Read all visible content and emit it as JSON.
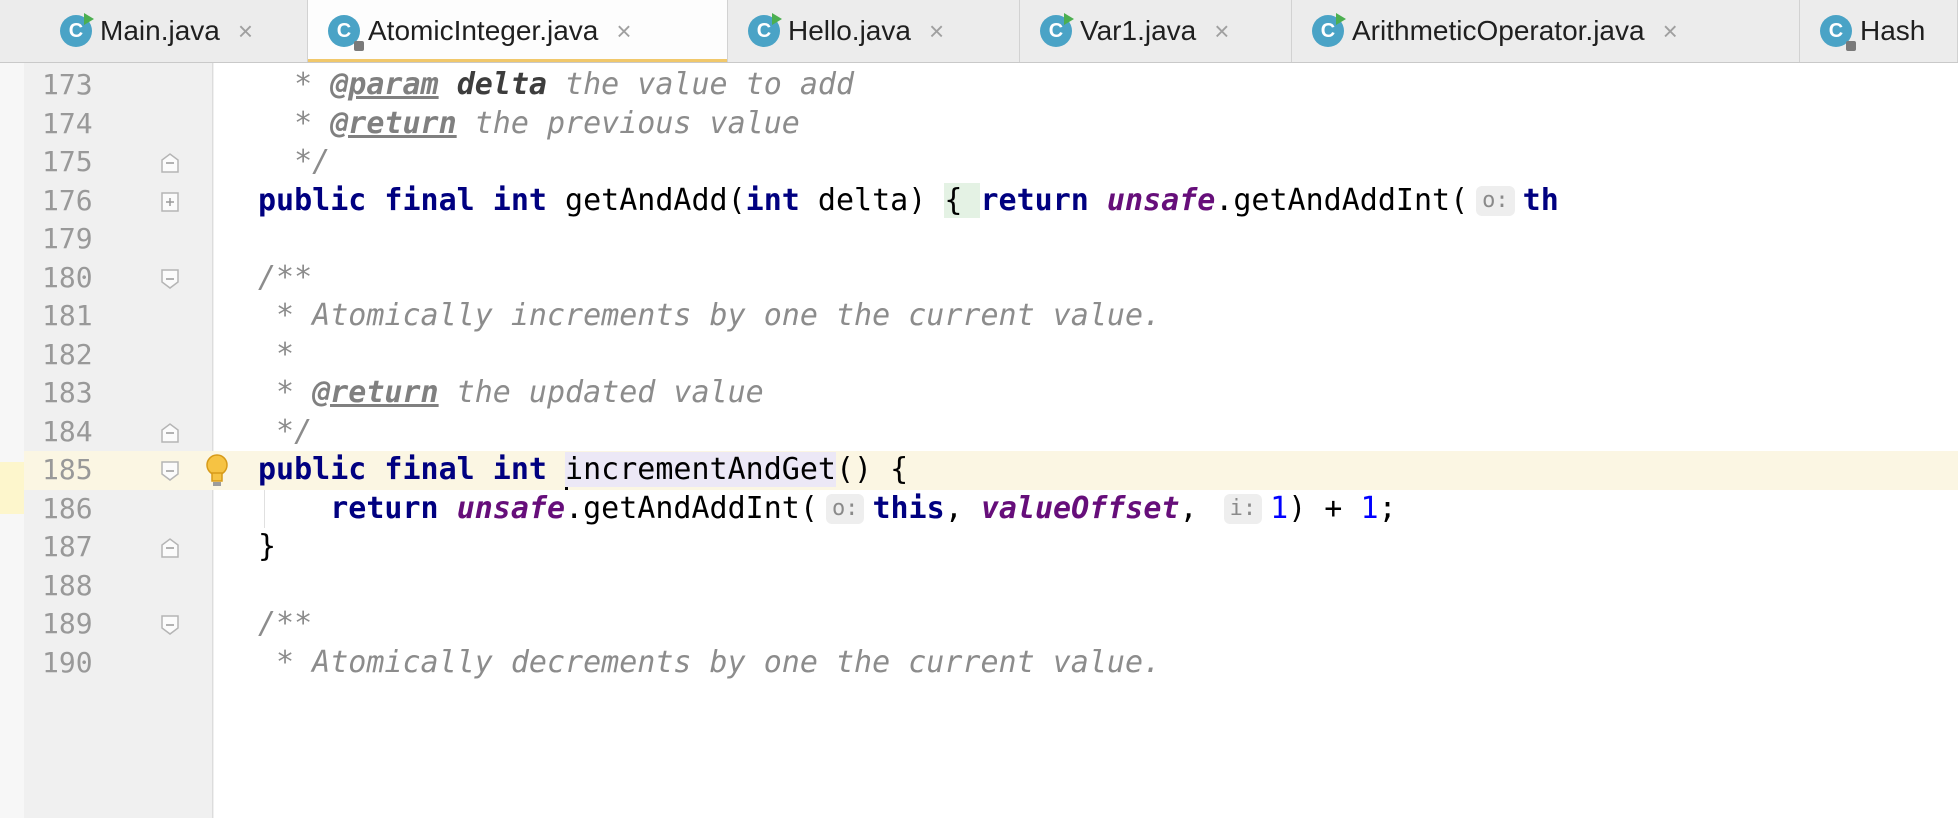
{
  "tabs": [
    {
      "name": "Main.java",
      "active": false,
      "locked": false
    },
    {
      "name": "AtomicInteger.java",
      "active": true,
      "locked": true
    },
    {
      "name": "Hello.java",
      "active": false,
      "locked": false
    },
    {
      "name": "Var1.java",
      "active": false,
      "locked": false
    },
    {
      "name": "ArithmeticOperator.java",
      "active": false,
      "locked": false
    },
    {
      "name": "Hash",
      "active": false,
      "locked": true
    }
  ],
  "tab_icon_letter": "C",
  "close_glyph": "×",
  "lines": [
    {
      "n": "173",
      "tokens": [
        [
          "  * ",
          "cm"
        ],
        [
          "@param",
          "tag"
        ],
        [
          " ",
          "cm"
        ],
        [
          "delta",
          "tagname"
        ],
        [
          " the value to add",
          "cm"
        ]
      ]
    },
    {
      "n": "174",
      "tokens": [
        [
          "  * ",
          "cm"
        ],
        [
          "@return",
          "tag"
        ],
        [
          " the previous value",
          "cm"
        ]
      ]
    },
    {
      "n": "175",
      "tokens": [
        [
          "  */",
          "cm"
        ]
      ]
    },
    {
      "n": "176",
      "tokens": [
        [
          "public final int ",
          "kw"
        ],
        [
          "getAndAdd(",
          ""
        ],
        [
          "int ",
          "kw"
        ],
        [
          "delta) ",
          ""
        ],
        [
          "{ ",
          "brace"
        ],
        [
          "return ",
          "kw"
        ],
        [
          "unsafe",
          "fld"
        ],
        [
          ".getAndAddInt(",
          ""
        ],
        [
          "o:",
          "hint"
        ],
        [
          "th",
          "kw"
        ]
      ]
    },
    {
      "n": "179",
      "tokens": []
    },
    {
      "n": "180",
      "tokens": [
        [
          "/**",
          "cm"
        ]
      ]
    },
    {
      "n": "181",
      "tokens": [
        [
          " * Atomically increments by one the current value.",
          "cm"
        ]
      ]
    },
    {
      "n": "182",
      "tokens": [
        [
          " *",
          "cm"
        ]
      ]
    },
    {
      "n": "183",
      "tokens": [
        [
          " * ",
          "cm"
        ],
        [
          "@return",
          "tag"
        ],
        [
          " the updated value",
          "cm"
        ]
      ]
    },
    {
      "n": "184",
      "tokens": [
        [
          " */",
          "cm"
        ]
      ]
    },
    {
      "n": "185",
      "tokens": [
        [
          "public final int ",
          "kw"
        ],
        [
          "",
          "caret"
        ],
        [
          "incrementAndGet",
          "sel"
        ],
        [
          "() {",
          ""
        ]
      ]
    },
    {
      "n": "186",
      "tokens": [
        [
          "    return ",
          "kw"
        ],
        [
          "unsafe",
          "fld"
        ],
        [
          ".getAndAddInt(",
          ""
        ],
        [
          "o:",
          "hint"
        ],
        [
          "this",
          "kw"
        ],
        [
          ", ",
          ""
        ],
        [
          "valueOffset",
          "fld"
        ],
        [
          ", ",
          ""
        ],
        [
          "i:",
          "hint"
        ],
        [
          "1",
          "num"
        ],
        [
          ") + ",
          ""
        ],
        [
          "1",
          "num"
        ],
        [
          ";",
          ""
        ]
      ]
    },
    {
      "n": "187",
      "tokens": [
        [
          "}",
          ""
        ]
      ]
    },
    {
      "n": "188",
      "tokens": []
    },
    {
      "n": "189",
      "tokens": [
        [
          "/**",
          "cm"
        ]
      ]
    },
    {
      "n": "190",
      "tokens": [
        [
          " * Atomically decrements by one the current value.",
          "cm"
        ]
      ]
    }
  ],
  "colors": {
    "keyword": "#000080",
    "comment": "#8c8c8c",
    "field": "#660e7a",
    "number": "#0000ff",
    "current_line": "#fbf6e3",
    "active_tab_underline": "#f1c86b"
  }
}
